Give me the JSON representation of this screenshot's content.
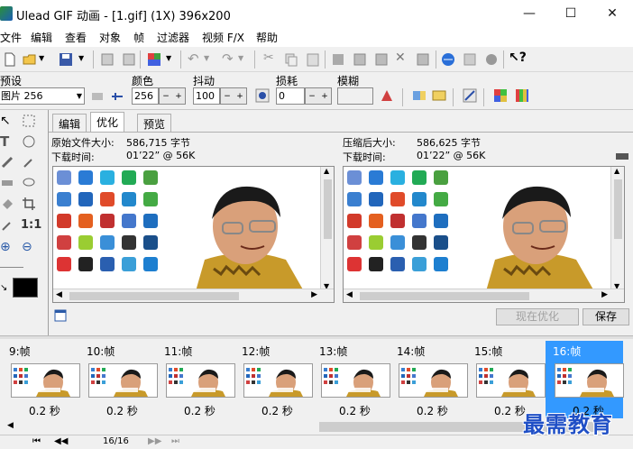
{
  "window": {
    "title": "Ulead GIF 动画 - [1.gif] (1X) 396x200",
    "minimize": "—",
    "maximize": "☐",
    "close": "✕"
  },
  "menu": [
    "文件",
    "编辑",
    "查看",
    "对象",
    "帧",
    "过滤器",
    "视频 F/X",
    "帮助"
  ],
  "toolbar2": {
    "preset_label": "预设",
    "preset_value": "图片 256",
    "colors_label": "颜色",
    "colors_value": "256",
    "dither_label": "抖动",
    "dither_value": "100",
    "loss_label": "损耗",
    "loss_value": "0",
    "blur_label": "模糊"
  },
  "tabs": [
    "编辑",
    "优化",
    "预览"
  ],
  "active_tab": "优化",
  "original": {
    "size_label": "原始文件大小:",
    "size_value": "586,715 字节",
    "download_label": "下载时间:",
    "download_value": "01’22” @ 56K"
  },
  "compressed": {
    "size_label": "压缩后大小:",
    "size_value": "586,625 字节",
    "download_label": "下载时间:",
    "download_value": "01’22” @ 56K"
  },
  "buttons": {
    "optimize_now": "现在优化",
    "save": "保存"
  },
  "frames": [
    {
      "label": "9:帧",
      "delay": "0.2 秒"
    },
    {
      "label": "10:帧",
      "delay": "0.2 秒"
    },
    {
      "label": "11:帧",
      "delay": "0.2 秒"
    },
    {
      "label": "12:帧",
      "delay": "0.2 秒"
    },
    {
      "label": "13:帧",
      "delay": "0.2 秒"
    },
    {
      "label": "14:帧",
      "delay": "0.2 秒"
    },
    {
      "label": "15:帧",
      "delay": "0.2 秒"
    },
    {
      "label": "16:帧",
      "delay": "0.2 秒"
    }
  ],
  "selected_frame": "16:帧",
  "bottom": {
    "frame_counter": "16/16"
  },
  "watermark": "最需教育",
  "colors": {
    "selection": "#3399ff",
    "watermark": "#1f4fc6"
  }
}
